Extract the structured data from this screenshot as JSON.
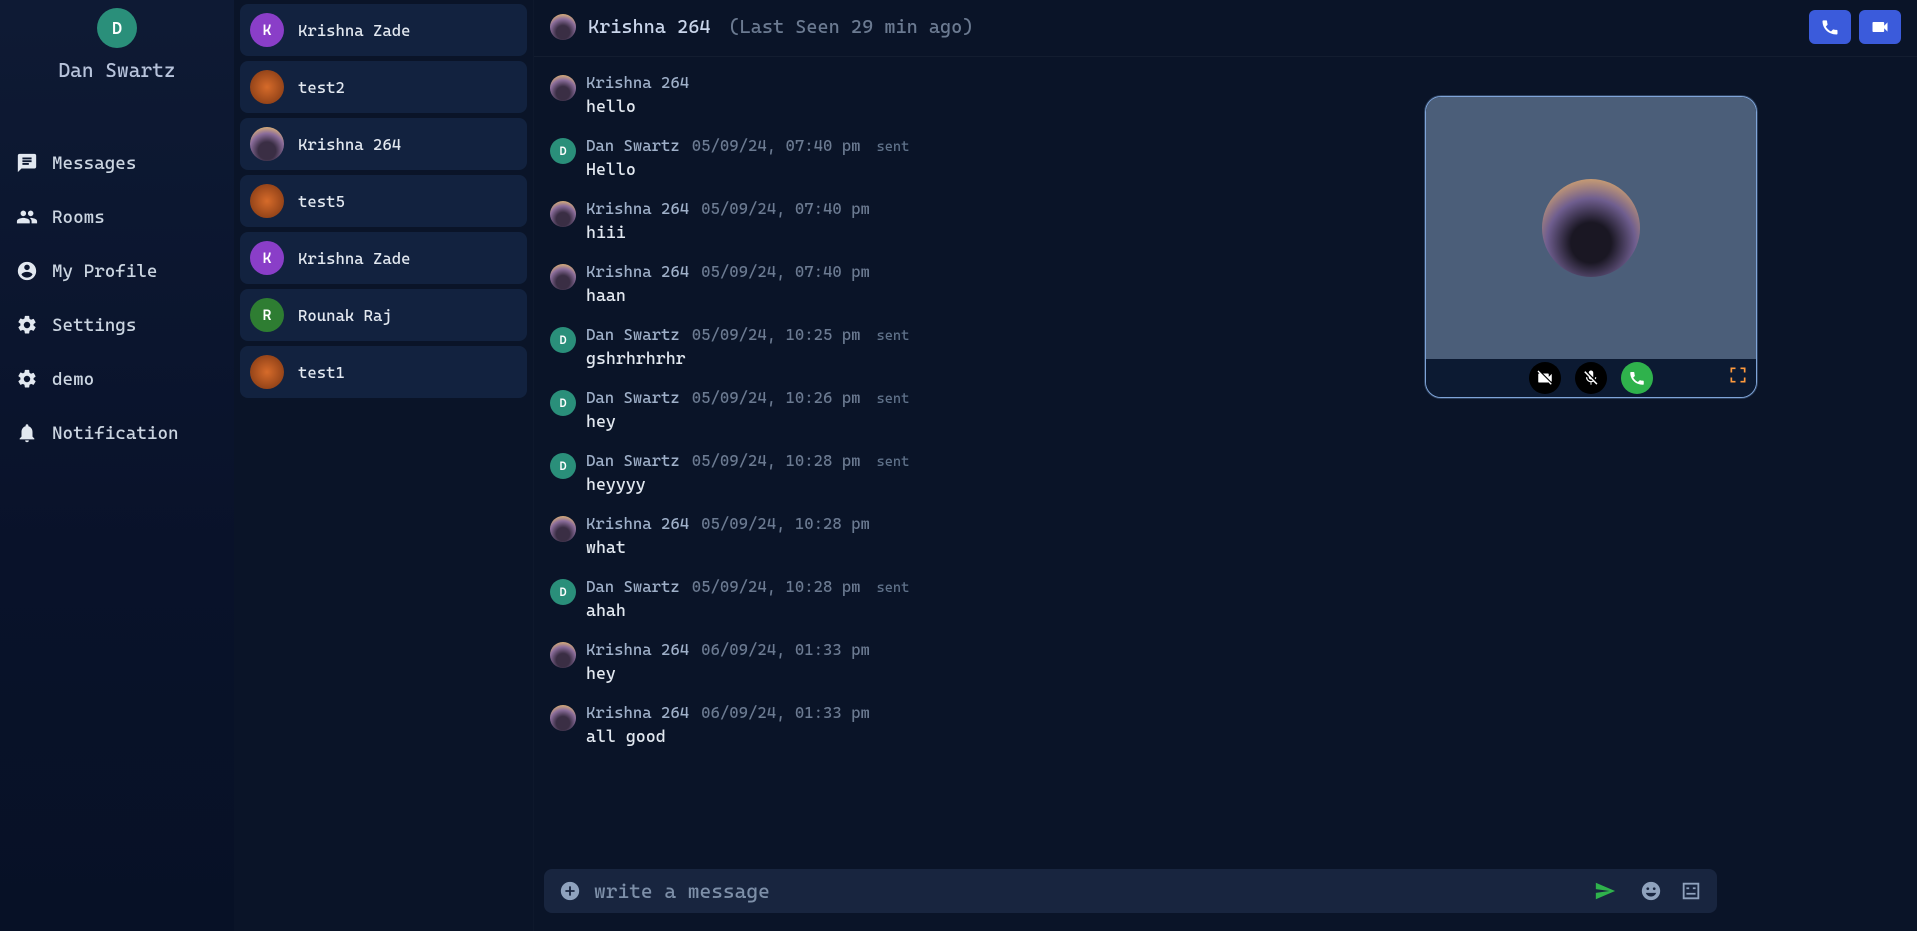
{
  "profile": {
    "initial": "D",
    "name": "Dan Swartz"
  },
  "nav": {
    "messages": "Messages",
    "rooms": "Rooms",
    "profile": "My Profile",
    "settings": "Settings",
    "demo": "demo",
    "notification": "Notification"
  },
  "conversations": [
    {
      "label": "Krishna Zade",
      "avatar": "purple",
      "initial": "K"
    },
    {
      "label": "test2",
      "avatar": "orange",
      "initial": ""
    },
    {
      "label": "Krishna 264",
      "avatar": "sunset",
      "initial": ""
    },
    {
      "label": "test5",
      "avatar": "orange",
      "initial": ""
    },
    {
      "label": "Krishna Zade",
      "avatar": "purple",
      "initial": "K"
    },
    {
      "label": "Rounak Raj",
      "avatar": "green",
      "initial": "R"
    },
    {
      "label": "test1",
      "avatar": "orange",
      "initial": ""
    }
  ],
  "chat": {
    "header": {
      "name": "Krishna 264",
      "last_seen": "(Last Seen 29 min ago)"
    },
    "composer_placeholder": "write a message",
    "messages": [
      {
        "sender": "Krishna 264",
        "avatar": "sunset",
        "initial": "",
        "time": "",
        "status": "",
        "text": "hello"
      },
      {
        "sender": "Dan Swartz",
        "avatar": "teal",
        "initial": "D",
        "time": "05/09/24, 07:40 pm",
        "status": "sent",
        "text": "Hello"
      },
      {
        "sender": "Krishna 264",
        "avatar": "sunset",
        "initial": "",
        "time": "05/09/24, 07:40 pm",
        "status": "",
        "text": "hiii"
      },
      {
        "sender": "Krishna 264",
        "avatar": "sunset",
        "initial": "",
        "time": "05/09/24, 07:40 pm",
        "status": "",
        "text": "haan"
      },
      {
        "sender": "Dan Swartz",
        "avatar": "teal",
        "initial": "D",
        "time": "05/09/24, 10:25 pm",
        "status": "sent",
        "text": "gshrhrhrhr"
      },
      {
        "sender": "Dan Swartz",
        "avatar": "teal",
        "initial": "D",
        "time": "05/09/24, 10:26 pm",
        "status": "sent",
        "text": "hey"
      },
      {
        "sender": "Dan Swartz",
        "avatar": "teal",
        "initial": "D",
        "time": "05/09/24, 10:28 pm",
        "status": "sent",
        "text": "heyyyy"
      },
      {
        "sender": "Krishna 264",
        "avatar": "sunset",
        "initial": "",
        "time": "05/09/24, 10:28 pm",
        "status": "",
        "text": "what"
      },
      {
        "sender": "Dan Swartz",
        "avatar": "teal",
        "initial": "D",
        "time": "05/09/24, 10:28 pm",
        "status": "sent",
        "text": "ahah"
      },
      {
        "sender": "Krishna 264",
        "avatar": "sunset",
        "initial": "",
        "time": "06/09/24, 01:33 pm",
        "status": "",
        "text": "hey"
      },
      {
        "sender": "Krishna 264",
        "avatar": "sunset",
        "initial": "",
        "time": "06/09/24, 01:33 pm",
        "status": "",
        "text": "all good"
      }
    ]
  }
}
